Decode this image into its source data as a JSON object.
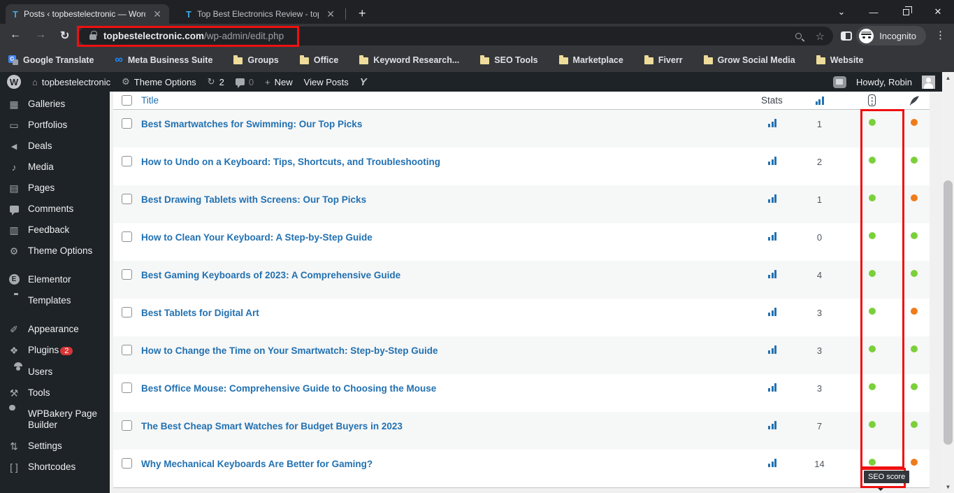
{
  "browser": {
    "tabs": [
      {
        "title": "Posts ‹ topbestelectronic — Word",
        "favicon": "T",
        "close": "✕"
      },
      {
        "title": "Top Best Electronics Review - top",
        "favicon": "T",
        "close": "✕"
      }
    ],
    "new_tab_label": "+",
    "window_controls": {
      "tab_search": "⌄",
      "minimize": "—",
      "close": "✕"
    },
    "url": {
      "domain": "topbestelectronic.com",
      "path": "/wp-admin/edit.php"
    },
    "incognito_label": "Incognito",
    "menu_dots": "⋮"
  },
  "bookmarks": [
    {
      "label": "Google Translate",
      "icon": "google-translate-icon"
    },
    {
      "label": "Meta Business Suite",
      "icon": "meta-icon"
    },
    {
      "label": "Groups",
      "icon": "folder-icon"
    },
    {
      "label": "Office",
      "icon": "folder-icon"
    },
    {
      "label": "Keyword Research...",
      "icon": "folder-icon"
    },
    {
      "label": "SEO Tools",
      "icon": "folder-icon"
    },
    {
      "label": "Marketplace",
      "icon": "folder-icon"
    },
    {
      "label": "Fiverr",
      "icon": "folder-icon"
    },
    {
      "label": "Grow Social Media",
      "icon": "folder-icon"
    },
    {
      "label": "Website",
      "icon": "folder-icon"
    }
  ],
  "admin_bar": {
    "wp_logo": "W",
    "site_name": "topbestelectronic",
    "theme_options": "Theme Options",
    "updates_count": "2",
    "comments_count": "0",
    "new_label": "New",
    "view_posts": "View Posts",
    "yoast": "Y",
    "howdy": "Howdy, Robin"
  },
  "sidebar": {
    "items": [
      {
        "label": "Galleries",
        "icon": "galleries-icon",
        "glyph": "▦",
        "gap": false
      },
      {
        "label": "Portfolios",
        "icon": "portfolios-icon",
        "glyph": "▭",
        "gap": false
      },
      {
        "label": "Deals",
        "icon": "megaphone-icon",
        "glyph": "◄",
        "gap": false
      },
      {
        "label": "Media",
        "icon": "media-icon",
        "glyph": "♪",
        "gap": false
      },
      {
        "label": "Pages",
        "icon": "pages-icon",
        "glyph": "▤",
        "gap": false
      },
      {
        "label": "Comments",
        "icon": "comments-icon",
        "glyph": "",
        "gap": false
      },
      {
        "label": "Feedback",
        "icon": "feedback-icon",
        "glyph": "▥",
        "gap": false
      },
      {
        "label": "Theme Options",
        "icon": "gear-icon",
        "glyph": "⚙",
        "gap": false
      },
      {
        "label": "Elementor",
        "icon": "elementor-icon",
        "glyph": "E",
        "gap": true
      },
      {
        "label": "Templates",
        "icon": "templates-icon",
        "glyph": "",
        "gap": false
      },
      {
        "label": "Appearance",
        "icon": "brush-icon",
        "glyph": "✐",
        "gap": true
      },
      {
        "label": "Plugins",
        "icon": "plugin-icon",
        "glyph": "❖",
        "gap": false,
        "badge": "2"
      },
      {
        "label": "Users",
        "icon": "users-icon",
        "glyph": "",
        "gap": false
      },
      {
        "label": "Tools",
        "icon": "tools-icon",
        "glyph": "⚒",
        "gap": false
      },
      {
        "label": "WPBakery Page Builder",
        "icon": "wpbakery-icon",
        "glyph": "",
        "gap": false
      },
      {
        "label": "Settings",
        "icon": "settings-icon",
        "glyph": "⇅",
        "gap": false
      },
      {
        "label": "Shortcodes",
        "icon": "shortcodes-icon",
        "glyph": "[ ]",
        "gap": false
      }
    ]
  },
  "table": {
    "headers": {
      "title": "Title",
      "stats": "Stats",
      "chart_icon": "bar-chart-icon",
      "seo_icon": "traffic-light-icon",
      "readability_icon": "feather-icon"
    },
    "rows": [
      {
        "title": "Best Smartwatches for Swimming: Our Top Picks",
        "links": "1",
        "seo": "green",
        "readability": "orange"
      },
      {
        "title": "How to Undo on a Keyboard: Tips, Shortcuts, and Troubleshooting",
        "links": "2",
        "seo": "green",
        "readability": "green"
      },
      {
        "title": "Best Drawing Tablets with Screens: Our Top Picks",
        "links": "1",
        "seo": "green",
        "readability": "orange"
      },
      {
        "title": "How to Clean Your Keyboard: A Step-by-Step Guide",
        "links": "0",
        "seo": "green",
        "readability": "green"
      },
      {
        "title": "Best Gaming Keyboards of 2023: A Comprehensive Guide",
        "links": "4",
        "seo": "green",
        "readability": "green"
      },
      {
        "title": "Best Tablets for Digital Art",
        "links": "3",
        "seo": "green",
        "readability": "orange"
      },
      {
        "title": "How to Change the Time on Your Smartwatch: Step-by-Step Guide",
        "links": "3",
        "seo": "green",
        "readability": "green"
      },
      {
        "title": "Best Office Mouse: Comprehensive Guide to Choosing the Mouse",
        "links": "3",
        "seo": "green",
        "readability": "green"
      },
      {
        "title": "The Best Cheap Smart Watches for Budget Buyers in 2023",
        "links": "7",
        "seo": "green",
        "readability": "green"
      },
      {
        "title": "Why Mechanical Keyboards Are Better for Gaming?",
        "links": "14",
        "seo": "green",
        "readability": "orange"
      }
    ]
  },
  "tooltip": {
    "label": "SEO score"
  },
  "colors": {
    "green": "#7ad03a",
    "orange": "#ee7c1b",
    "link_blue": "#2271b1",
    "highlight_red": "#ef1010"
  }
}
